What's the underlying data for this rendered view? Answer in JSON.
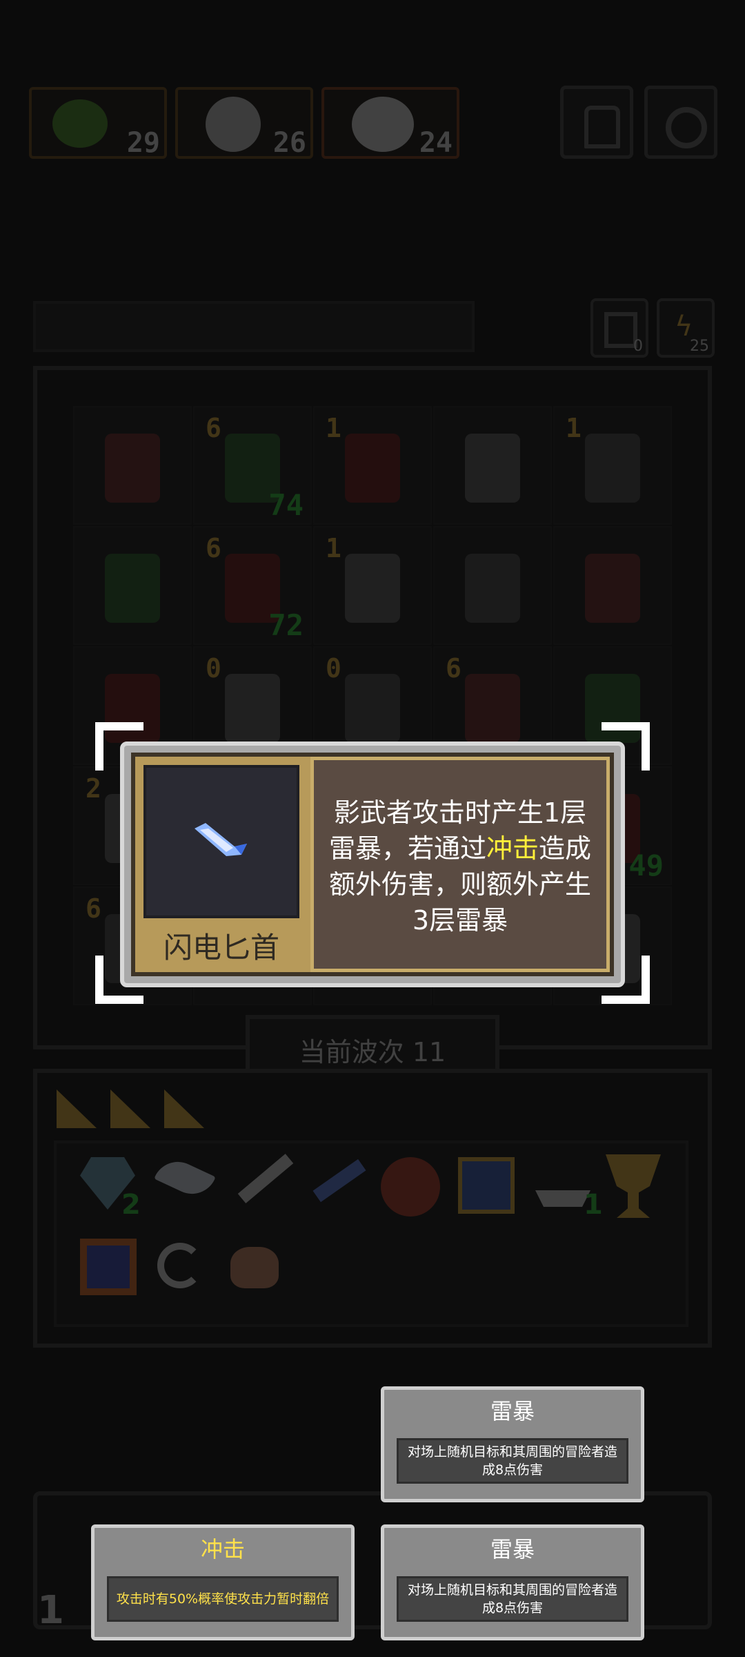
{
  "resources": [
    {
      "icon": "green-slime-icon",
      "count": "29"
    },
    {
      "icon": "skull-warrior-icon",
      "count": "26"
    },
    {
      "icon": "demon-beast-icon",
      "count": "24"
    }
  ],
  "top_buttons": [
    "help-icon",
    "settings-icon"
  ],
  "round_counters": [
    {
      "icon": "refresh-icon",
      "value": "0"
    },
    {
      "icon": "lightning-icon",
      "value": "25"
    }
  ],
  "board": {
    "rows": [
      [
        {
          "lvl": "",
          "hp": ""
        },
        {
          "lvl": "6",
          "hp": "74"
        },
        {
          "lvl": "1",
          "hp": ""
        },
        {
          "lvl": "",
          "hp": ""
        },
        {
          "lvl": "1",
          "hp": ""
        }
      ],
      [
        {
          "lvl": "",
          "hp": ""
        },
        {
          "lvl": "6",
          "hp": "72"
        },
        {
          "lvl": "1",
          "hp": ""
        },
        {
          "lvl": "",
          "hp": ""
        },
        {
          "lvl": "",
          "hp": ""
        }
      ],
      [
        {
          "lvl": "",
          "hp": ""
        },
        {
          "lvl": "0",
          "hp": ""
        },
        {
          "lvl": "0",
          "hp": ""
        },
        {
          "lvl": "6",
          "hp": ""
        },
        {
          "lvl": "",
          "hp": ""
        }
      ],
      [
        {
          "lvl": "2",
          "hp": ""
        },
        {
          "lvl": "",
          "hp": ""
        },
        {
          "lvl": "",
          "hp": ""
        },
        {
          "lvl": "",
          "hp": ""
        },
        {
          "lvl": "",
          "hp": "49"
        }
      ],
      [
        {
          "lvl": "6",
          "hp": ""
        },
        {
          "lvl": "",
          "hp": ""
        },
        {
          "lvl": "",
          "hp": ""
        },
        {
          "lvl": "",
          "hp": ""
        },
        {
          "lvl": "",
          "hp": ""
        }
      ]
    ]
  },
  "wave_label": "当前波次 11",
  "inventory_counts": {
    "gem": "2",
    "ship": "1"
  },
  "popup": {
    "item_name": "闪电匕首",
    "desc_before": "影武者攻击时产生1层雷暴，若通过",
    "desc_highlight": "冲击",
    "desc_after": "造成额外伤害，则额外产生3层雷暴"
  },
  "cards": [
    {
      "title": "雷暴",
      "body": "对场上随机目标和其周围的冒险者造成8点伤害"
    },
    {
      "title": "冲击",
      "body": "攻击时有50%概率使攻击力暂时翻倍"
    },
    {
      "title": "雷暴",
      "body": "对场上随机目标和其周围的冒险者造成8点伤害"
    }
  ],
  "bottom_left_value": "1",
  "colors": {
    "highlight": "#ffef3a",
    "hp": "#2fbf3b",
    "level": "#d3a63a"
  }
}
